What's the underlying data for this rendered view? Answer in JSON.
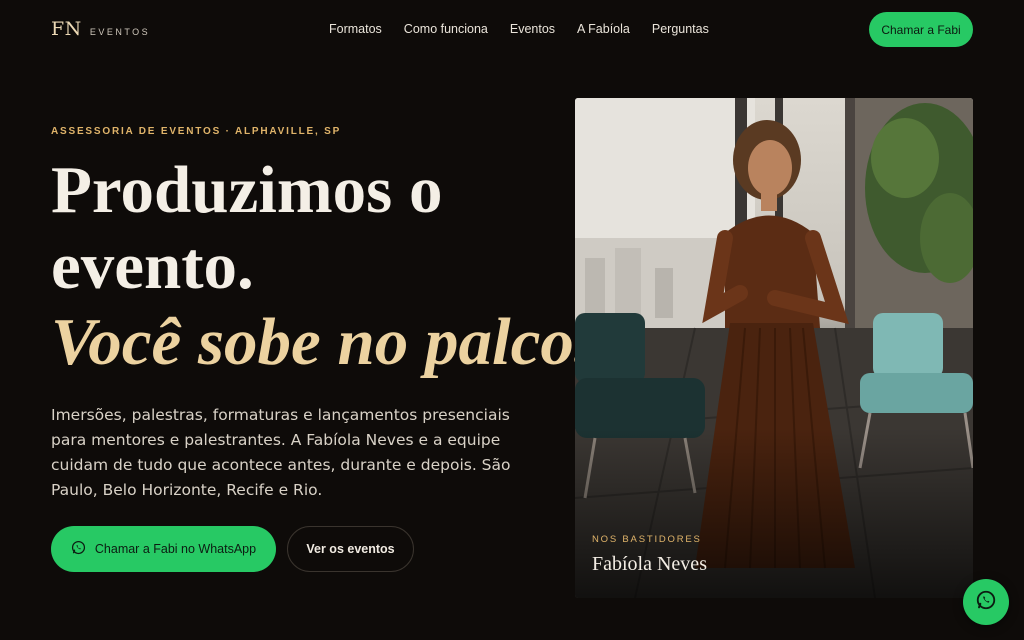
{
  "brand": {
    "mark": "FN",
    "word": "EVENTOS"
  },
  "nav": {
    "items": [
      {
        "label": "Formatos"
      },
      {
        "label": "Como funciona"
      },
      {
        "label": "Eventos"
      },
      {
        "label": "A Fabíola"
      },
      {
        "label": "Perguntas"
      }
    ],
    "cta": "Chamar a Fabi"
  },
  "hero": {
    "eyebrow": "ASSESSORIA DE EVENTOS · ALPHAVILLE, SP",
    "headline_line1": "Produzimos o",
    "headline_line2": "evento.",
    "headline_accent": "Você sobe no palco.",
    "lead": "Imersões, palestras, formaturas e lançamentos presenciais para mentores e palestrantes. A Fabíola Neves e a equipe cuidam de tudo que acontece antes, durante e depois. São Paulo, Belo Horizonte, Recife e Rio.",
    "primary_button": "Chamar a Fabi no WhatsApp",
    "secondary_button": "Ver os eventos"
  },
  "photo_card": {
    "kicker": "NOS BASTIDORES",
    "name": "Fabíola Neves"
  },
  "colors": {
    "background": "#0e0b09",
    "accent_green": "#27c964",
    "accent_gold": "#e0b46a",
    "headline_cream": "#ecd2a0"
  },
  "icons": {
    "whatsapp": "whatsapp-icon"
  }
}
